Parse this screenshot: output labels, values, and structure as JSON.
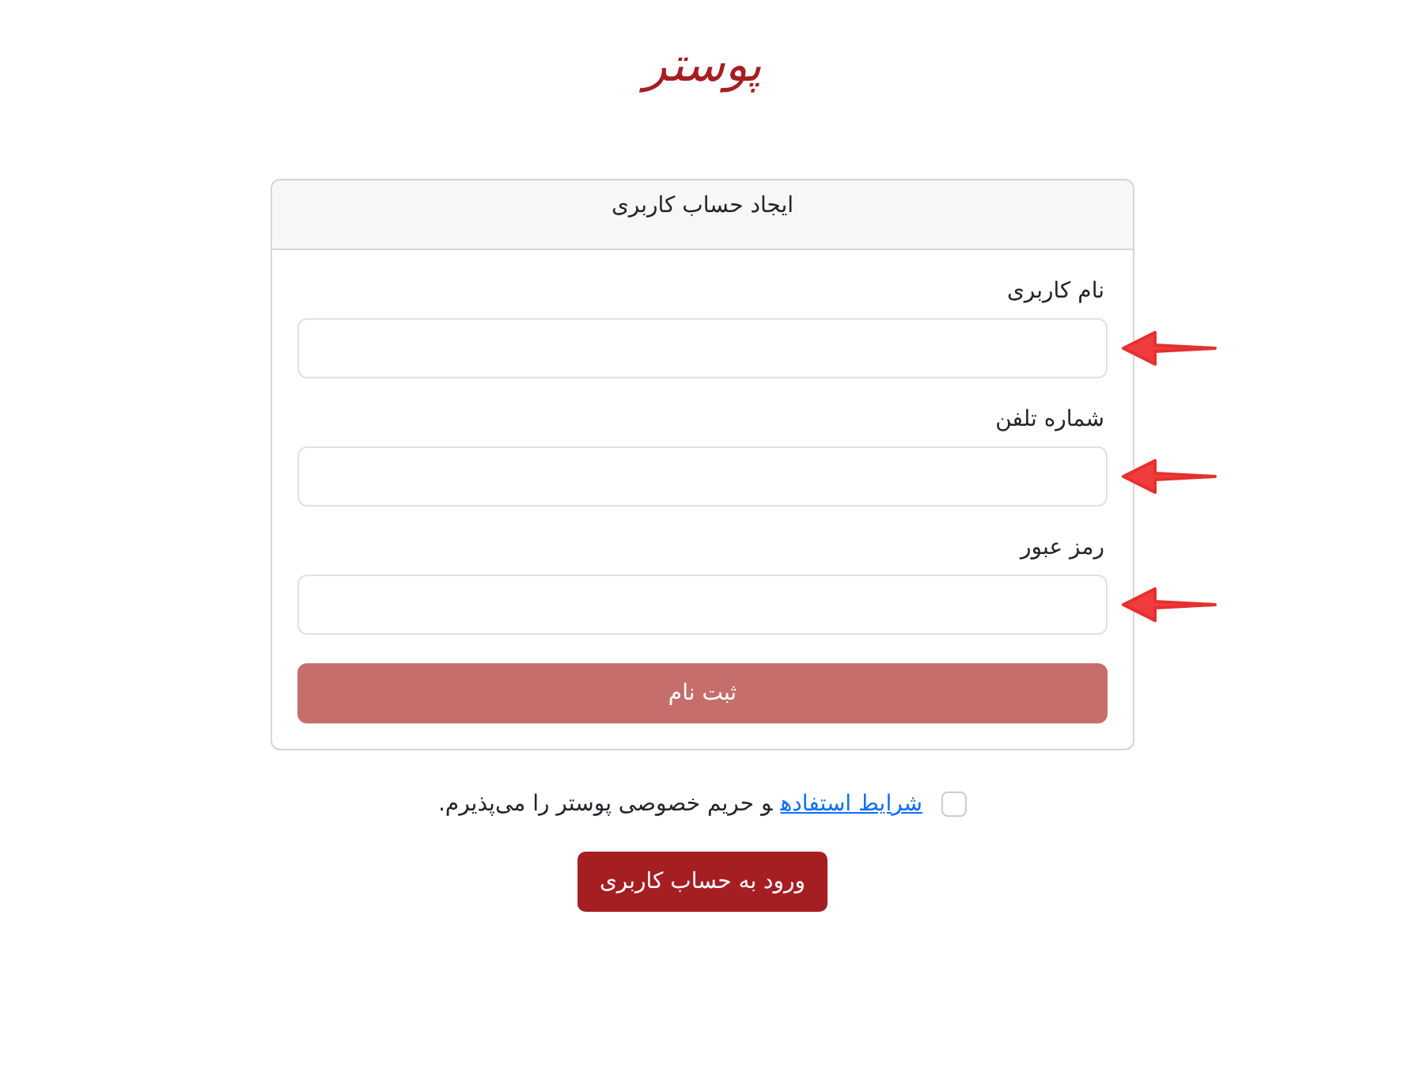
{
  "logo": "پوستر",
  "card": {
    "title": "ایجاد حساب کاربری",
    "fields": [
      {
        "label": "نام کاربری"
      },
      {
        "label": "شماره تلفن"
      },
      {
        "label": "رمز عبور"
      }
    ],
    "submit": {
      "label": "ثبت نام",
      "disabled": true
    }
  },
  "terms": {
    "checked": false,
    "link": "شرایط استفاده",
    "text": "و حریم خصوصی پوستر را می‌پذیرم."
  },
  "login_button": "ورود به حساب کاربری"
}
